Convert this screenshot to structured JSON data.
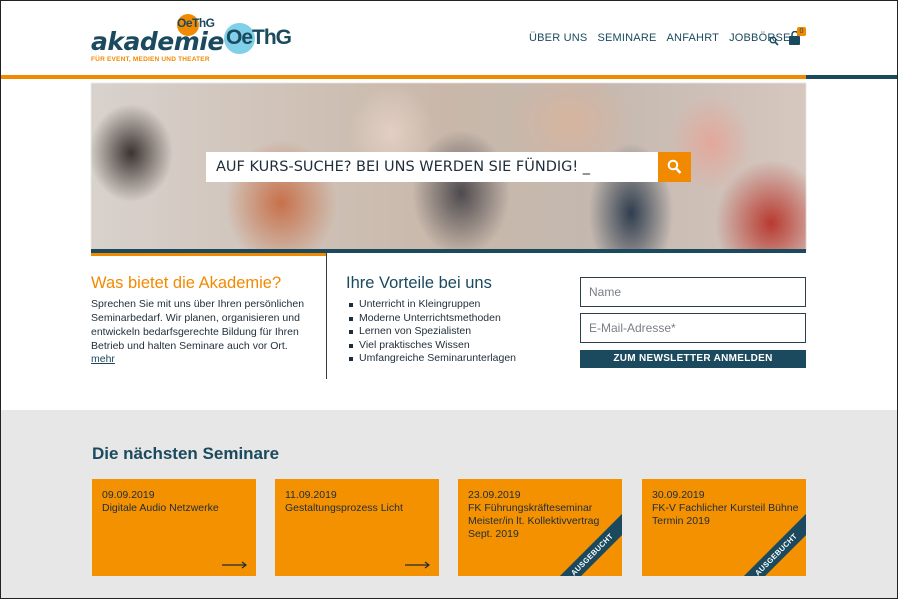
{
  "header": {
    "logo_word": "akademie",
    "logo_badge": "OeThG",
    "logo_tagline": "FÜR EVENT, MEDIEN UND THEATER",
    "partner_logo": "OeThG",
    "nav": [
      {
        "label": "ÜBER UNS"
      },
      {
        "label": "SEMINARE"
      },
      {
        "label": "ANFAHRT"
      },
      {
        "label": "JOBBÖRSE"
      }
    ],
    "search_icon": "search-icon",
    "cart_icon": "cart-icon",
    "cart_count": "0"
  },
  "hero": {
    "search_text": "AUF KURS-SUCHE? BEI UNS WERDEN SIE FÜNDIG! _",
    "search_button_icon": "search-icon"
  },
  "about": {
    "title": "Was bietet die Akademie?",
    "text": "Sprechen Sie mit uns über Ihren persönlichen Seminarbedarf. Wir planen, organisieren und entwickeln bedarfsgerechte Bildung für Ihren Betrieb und halten Seminare auch vor Ort.",
    "more": "mehr"
  },
  "benefits": {
    "title": "Ihre Vorteile bei uns",
    "items": [
      "Unterricht in Kleingruppen",
      "Moderne Unterrichtsmethoden",
      "Lernen von Spezialisten",
      "Viel praktisches Wissen",
      "Umfangreiche Seminarunterlagen"
    ]
  },
  "newsletter": {
    "name_placeholder": "Name",
    "email_placeholder": "E-Mail-Adresse*",
    "button": "ZUM NEWSLETTER ANMELDEN"
  },
  "seminars": {
    "title": "Die nächsten Seminare",
    "cards": [
      {
        "date": "09.09.2019",
        "title": "Digitale Audio Netzwerke",
        "badge": ""
      },
      {
        "date": "11.09.2019",
        "title": "Gestaltungsprozess Licht",
        "badge": ""
      },
      {
        "date": "23.09.2019",
        "title": "FK Führungskräfteseminar Meister/in lt. Kollektivvertrag Sept. 2019",
        "badge": "AUSGEBUCHT"
      },
      {
        "date": "30.09.2019",
        "title": "FK-V Fachlicher Kursteil Bühne Termin 2019",
        "badge": "AUSGEBUCHT"
      }
    ]
  },
  "colors": {
    "accent_orange": "#f18a00",
    "navy": "#1b4a5e",
    "section_gray": "#e7e7e7"
  }
}
